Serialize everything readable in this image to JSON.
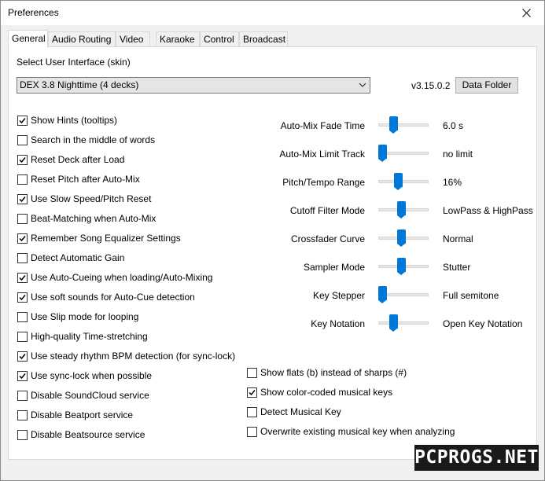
{
  "window": {
    "title": "Preferences"
  },
  "tabs": [
    "General",
    "Audio Routing",
    "Video",
    "Karaoke",
    "Control",
    "Broadcast"
  ],
  "skin": {
    "label": "Select User Interface (skin)",
    "selected": "DEX 3.8 Nighttime (4 decks)",
    "version": "v3.15.0.2",
    "data_folder_button": "Data Folder"
  },
  "left_options": [
    {
      "label": "Show Hints (tooltips)",
      "checked": true
    },
    {
      "label": "Search in the middle of words",
      "checked": false
    },
    {
      "label": "Reset Deck after Load",
      "checked": true
    },
    {
      "label": "Reset Pitch after Auto-Mix",
      "checked": false
    },
    {
      "label": "Use Slow Speed/Pitch Reset",
      "checked": true
    },
    {
      "label": "Beat-Matching when Auto-Mix",
      "checked": false
    },
    {
      "label": "Remember Song Equalizer Settings",
      "checked": true
    },
    {
      "label": "Detect Automatic Gain",
      "checked": false
    },
    {
      "label": "Use Auto-Cueing when loading/Auto-Mixing",
      "checked": true
    },
    {
      "label": "Use soft sounds for Auto-Cue detection",
      "checked": true
    },
    {
      "label": "Use Slip mode for looping",
      "checked": false
    },
    {
      "label": "High-quality Time-stretching",
      "checked": false
    },
    {
      "label": "Use steady rhythm BPM detection (for sync-lock)",
      "checked": true
    },
    {
      "label": "Use sync-lock when possible",
      "checked": true
    },
    {
      "label": "Disable SoundCloud service",
      "checked": false
    },
    {
      "label": "Disable Beatport service",
      "checked": false
    },
    {
      "label": "Disable Beatsource service",
      "checked": false
    }
  ],
  "sliders": [
    {
      "label": "Auto-Mix Fade Time",
      "value": "6.0 s",
      "level": 0.27
    },
    {
      "label": "Auto-Mix Limit Track",
      "value": "no limit",
      "level": 0.0
    },
    {
      "label": "Pitch/Tempo Range",
      "value": "16%",
      "level": 0.38
    },
    {
      "label": "Cutoff Filter Mode",
      "value": "LowPass & HighPass",
      "level": 0.46
    },
    {
      "label": "Crossfader Curve",
      "value": "Normal",
      "level": 0.46
    },
    {
      "label": "Sampler Mode",
      "value": "Stutter",
      "level": 0.46
    },
    {
      "label": "Key Stepper",
      "value": "Full semitone",
      "level": 0.0
    },
    {
      "label": "Key Notation",
      "value": "Open Key Notation",
      "level": 0.27
    }
  ],
  "key_options": [
    {
      "label": "Show flats (b) instead of sharps (#)",
      "checked": false
    },
    {
      "label": "Show color-coded musical keys",
      "checked": true
    },
    {
      "label": "Detect Musical Key",
      "checked": false
    },
    {
      "label": "Overwrite existing musical key when analyzing",
      "checked": false
    }
  ],
  "watermark": "PCPROGS.NET",
  "colors": {
    "accent": "#0078d7"
  }
}
